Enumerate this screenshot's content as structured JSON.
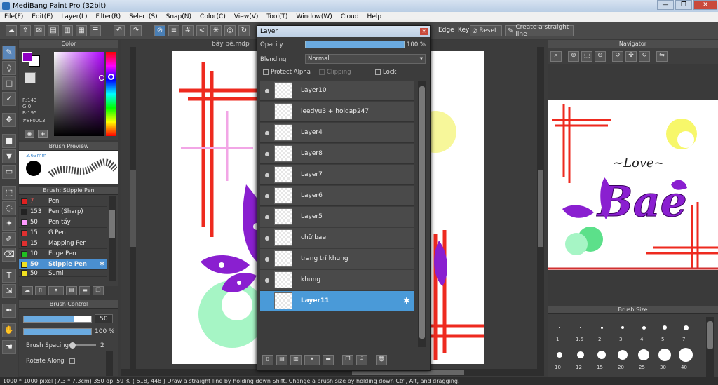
{
  "window": {
    "title": "MediBang Paint Pro (32bit)",
    "min": "—",
    "max": "❐",
    "close": "✕"
  },
  "menu": [
    "File(F)",
    "Edit(E)",
    "Layer(L)",
    "Filter(R)",
    "Select(S)",
    "Snap(N)",
    "Color(C)",
    "View(V)",
    "Tool(T)",
    "Window(W)",
    "Cloud",
    "Help"
  ],
  "toolbar": {
    "edge_label": "Edge",
    "key_label": "Key",
    "reset_label": "Reset",
    "straight_line_label": "Create a straight line"
  },
  "color_panel": {
    "title": "Color",
    "r": "R:143",
    "g": "G:0",
    "b": "B:195",
    "hex": "#8F00C3",
    "primary": "#8f00c3"
  },
  "brush_preview": {
    "title": "Brush Preview",
    "size": "3.63mm"
  },
  "brush_list": {
    "title": "Brush: Stipple Pen",
    "items": [
      {
        "size": "7",
        "name": "Pen",
        "color": "#e02020"
      },
      {
        "size": "153",
        "name": "Pen (Sharp)",
        "color": "#222222"
      },
      {
        "size": "50",
        "name": "Pen tẩy",
        "color": "#ff99ff"
      },
      {
        "size": "15",
        "name": "G Pen",
        "color": "#e03030"
      },
      {
        "size": "15",
        "name": "Mapping Pen",
        "color": "#e03030"
      },
      {
        "size": "10",
        "name": "Edge Pen",
        "color": "#20c020"
      },
      {
        "size": "50",
        "name": "Stipple Pen",
        "color": "#f0e020"
      },
      {
        "size": "50",
        "name": "Sumi",
        "color": "#f0e020"
      }
    ]
  },
  "brush_control": {
    "title": "Brush Control",
    "size_value": "50",
    "opacity_value": "100 %",
    "spacing_label": "Brush Spacing",
    "spacing_value": "2",
    "rotate_label": "Rotate Along",
    "size_fill": 0.74,
    "opacity_fill": 1.0
  },
  "document": {
    "tab": "bây bê.mdp"
  },
  "layer_panel": {
    "title": "Layer",
    "opacity_label": "Opacity",
    "opacity_value": "100 %",
    "blending_label": "Blending",
    "blending_value": "Normal",
    "protect_alpha": "Protect Alpha",
    "clipping": "Clipping",
    "lock": "Lock",
    "layers": [
      {
        "name": "Layer10",
        "visible": true
      },
      {
        "name": "leedyu3 + hoidap247",
        "visible": false
      },
      {
        "name": "Layer4",
        "visible": true
      },
      {
        "name": "Layer8",
        "visible": true
      },
      {
        "name": "Layer7",
        "visible": true
      },
      {
        "name": "Layer6",
        "visible": true
      },
      {
        "name": "Layer5",
        "visible": true
      },
      {
        "name": "chữ bae",
        "visible": true
      },
      {
        "name": "trang trí khung",
        "visible": true
      },
      {
        "name": "khung",
        "visible": true
      },
      {
        "name": "Layer11",
        "visible": false,
        "selected": true
      }
    ]
  },
  "navigator": {
    "title": "Navigator",
    "text_love": "~Love~",
    "text_bae": "Bae"
  },
  "brush_size": {
    "title": "Brush Size",
    "labels": [
      "1",
      "1.5",
      "2",
      "3",
      "4",
      "5",
      "7",
      "10",
      "12",
      "15",
      "20",
      "25",
      "30",
      "40"
    ]
  },
  "status": {
    "text": "1000 * 1000 pixel   (7.3 * 7.3cm)   350 dpi   59 %   ( 518, 448 )   Draw a straight line by holding down Shift. Change a brush size by holding down Ctrl, Alt, and dragging."
  }
}
